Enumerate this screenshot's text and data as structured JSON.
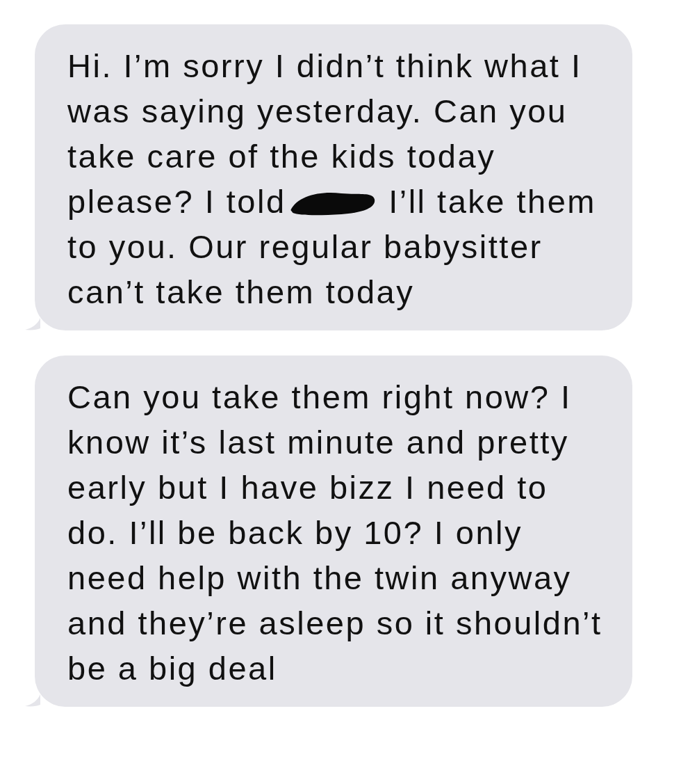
{
  "messages": [
    {
      "tail": true,
      "segments": [
        {
          "kind": "text",
          "text": "Hi. I’m sorry I didn’t think what I was saying yesterday. Can you take care of the kids today please? I told"
        },
        {
          "kind": "redaction"
        },
        {
          "kind": "text",
          "text": "I’ll take them to you. Our regular babysitter can’t take them today"
        }
      ]
    },
    {
      "tail": true,
      "segments": [
        {
          "kind": "text",
          "text": "Can you take them right now? I know it’s last minute and pretty early but I have bizz I need to do. I’ll be back by 10? I only need help with the twin anyway and they’re asleep so it shouldn’t be a big deal"
        }
      ]
    }
  ]
}
